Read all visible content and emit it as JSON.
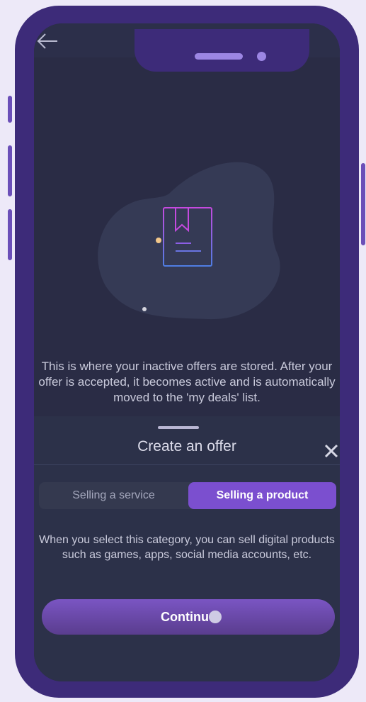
{
  "device": {
    "frame_color": "#3d2b79",
    "screen_color": "#2a2c45"
  },
  "header": {
    "back_icon": "arrow-left-icon"
  },
  "empty_state": {
    "icon": "bookmark-document-icon",
    "message": "This is where your inactive offers are stored. After your offer is accepted, it becomes active and is automatically moved to the 'my deals' list."
  },
  "sheet": {
    "title": "Create an offer",
    "close_icon": "close-icon",
    "segments": [
      {
        "label": "Selling a service",
        "selected": false
      },
      {
        "label": "Selling a product",
        "selected": true
      }
    ],
    "description": "When you select this category, you can sell digital products such as games, apps, social media accounts, etc.",
    "continue_label": "Continue"
  },
  "colors": {
    "accent": "#7b4fcf",
    "magenta_dot": "#e0389d"
  }
}
